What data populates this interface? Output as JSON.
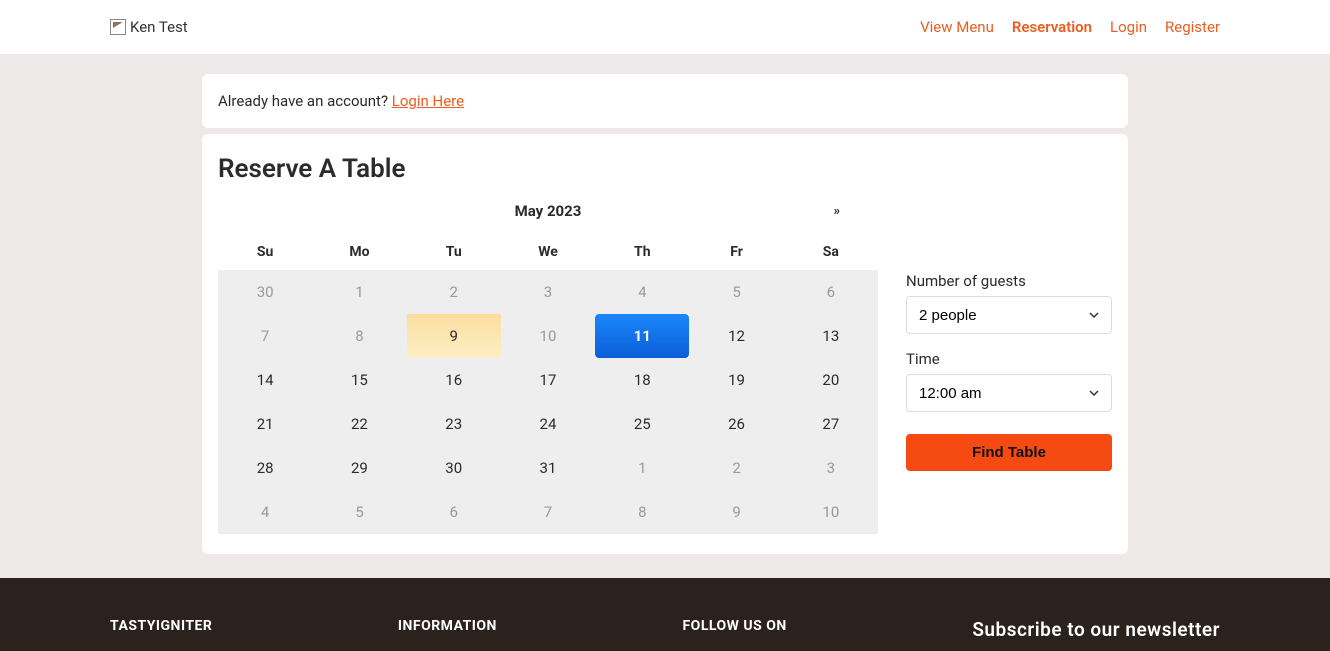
{
  "header": {
    "logo_text": "Ken Test",
    "nav": {
      "view_menu": "View Menu",
      "reservation": "Reservation",
      "login": "Login",
      "register": "Register"
    }
  },
  "login_bar": {
    "prompt": "Already have an account? ",
    "link": "Login Here"
  },
  "page_title": "Reserve A Table",
  "calendar": {
    "title": "May 2023",
    "next": "»",
    "dow": [
      "Su",
      "Mo",
      "Tu",
      "We",
      "Th",
      "Fr",
      "Sa"
    ],
    "cells": [
      {
        "n": "30",
        "muted": true
      },
      {
        "n": "1",
        "muted": true
      },
      {
        "n": "2",
        "muted": true
      },
      {
        "n": "3",
        "muted": true
      },
      {
        "n": "4",
        "muted": true
      },
      {
        "n": "5",
        "muted": true
      },
      {
        "n": "6",
        "muted": true
      },
      {
        "n": "7",
        "muted": true
      },
      {
        "n": "8",
        "muted": true
      },
      {
        "n": "9",
        "today": true
      },
      {
        "n": "10",
        "muted": true
      },
      {
        "n": "11",
        "selected": true
      },
      {
        "n": "12"
      },
      {
        "n": "13"
      },
      {
        "n": "14"
      },
      {
        "n": "15"
      },
      {
        "n": "16"
      },
      {
        "n": "17"
      },
      {
        "n": "18"
      },
      {
        "n": "19"
      },
      {
        "n": "20"
      },
      {
        "n": "21"
      },
      {
        "n": "22"
      },
      {
        "n": "23"
      },
      {
        "n": "24"
      },
      {
        "n": "25"
      },
      {
        "n": "26"
      },
      {
        "n": "27"
      },
      {
        "n": "28"
      },
      {
        "n": "29"
      },
      {
        "n": "30"
      },
      {
        "n": "31"
      },
      {
        "n": "1",
        "muted": true
      },
      {
        "n": "2",
        "muted": true
      },
      {
        "n": "3",
        "muted": true
      },
      {
        "n": "4",
        "muted": true
      },
      {
        "n": "5",
        "muted": true
      },
      {
        "n": "6",
        "muted": true
      },
      {
        "n": "7",
        "muted": true
      },
      {
        "n": "8",
        "muted": true
      },
      {
        "n": "9",
        "muted": true
      },
      {
        "n": "10",
        "muted": true
      }
    ]
  },
  "form": {
    "guests_label": "Number of guests",
    "guests_value": "2 people",
    "time_label": "Time",
    "time_value": "12:00 am",
    "find_button": "Find Table"
  },
  "footer": {
    "col1": "TASTYIGNITER",
    "col2": "INFORMATION",
    "col3": "FOLLOW US ON",
    "col4": "Subscribe to our newsletter"
  }
}
